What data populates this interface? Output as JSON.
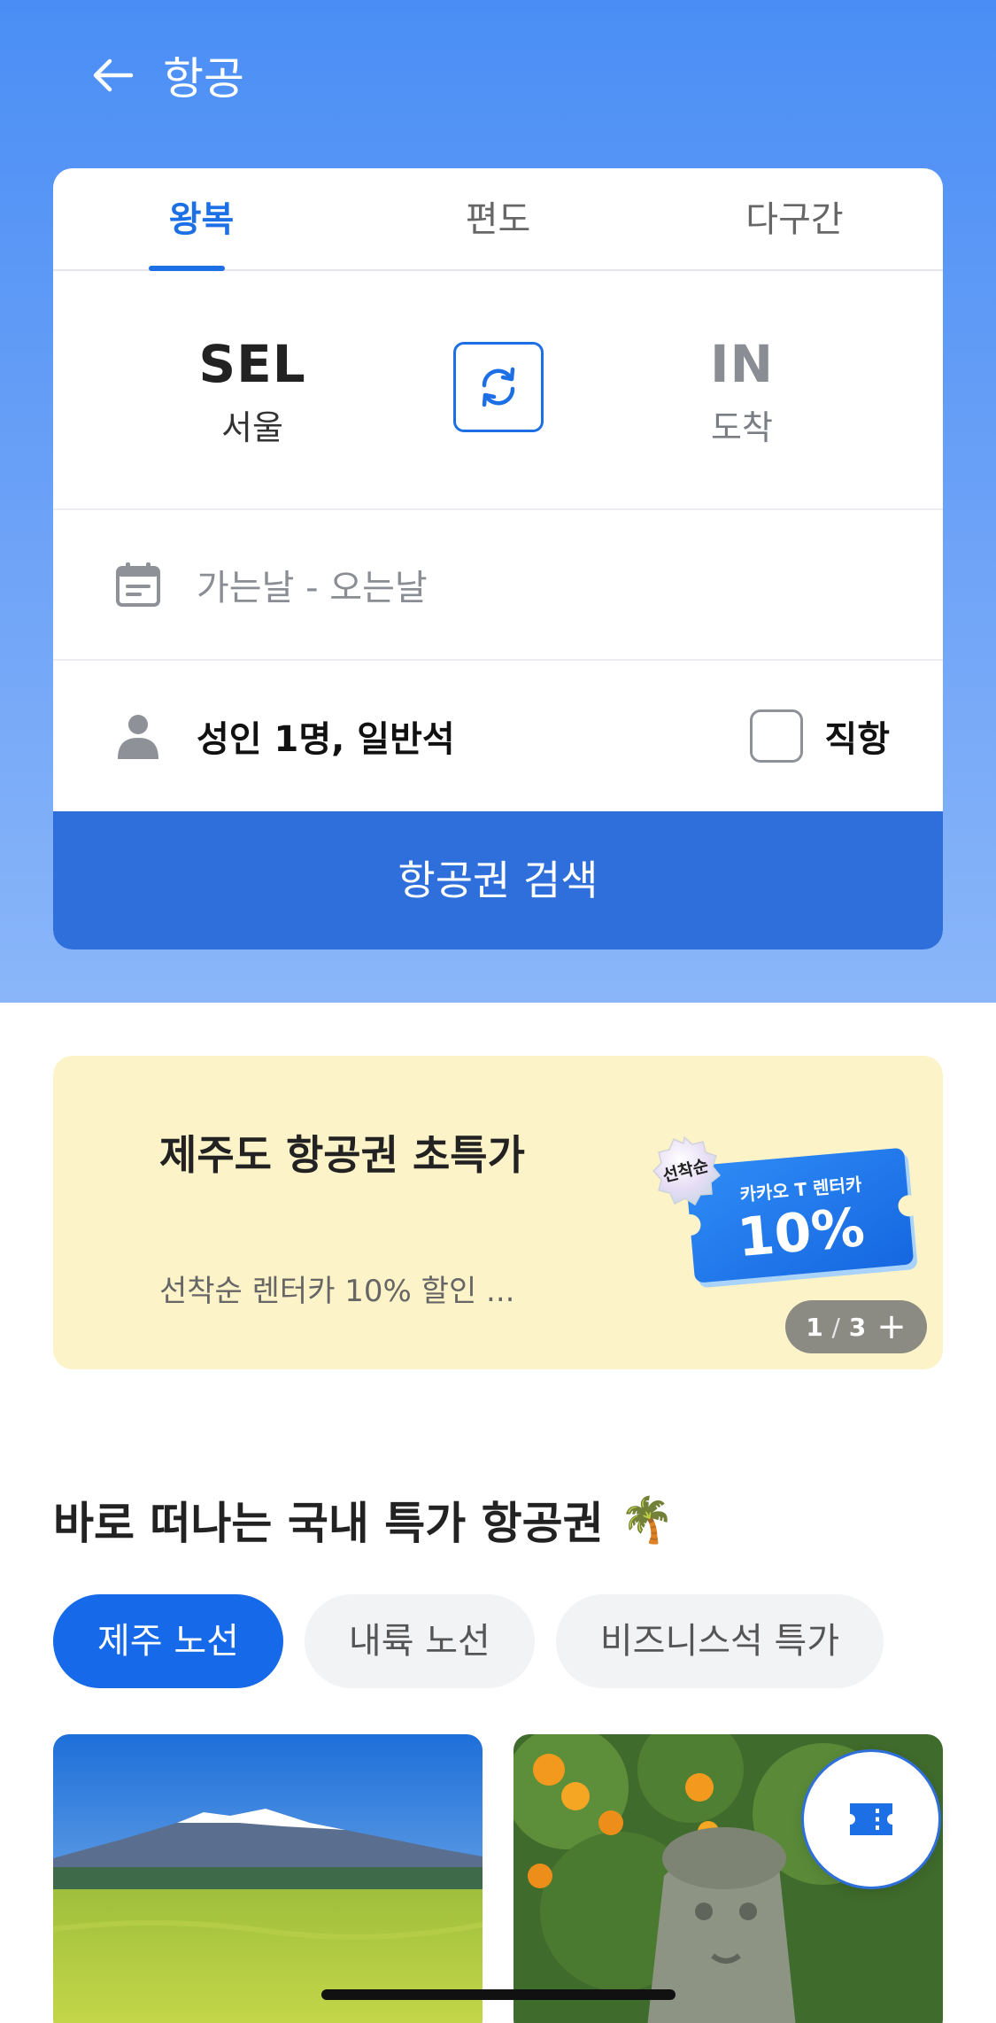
{
  "header": {
    "title": "항공",
    "back_icon": "arrow-left-icon"
  },
  "trip_tabs": [
    {
      "label": "왕복",
      "active": true
    },
    {
      "label": "편도",
      "active": false
    },
    {
      "label": "다구간",
      "active": false
    }
  ],
  "route": {
    "departure": {
      "code": "SEL",
      "name": "서울"
    },
    "arrival": {
      "code": "IN",
      "name": "도착"
    },
    "swap_icon": "swap-arrows-icon"
  },
  "dates": {
    "placeholder": "가는날 - 오는날",
    "icon": "calendar-icon"
  },
  "passengers": {
    "label": "성인 1명, 일반석",
    "icon": "person-icon"
  },
  "direct": {
    "label": "직항",
    "checked": false
  },
  "search_button": {
    "label": "항공권 검색"
  },
  "banner": {
    "title": "제주도 항공권 초특가",
    "subtitle": "선착순 렌터카 10% 할인 ...",
    "coupon": {
      "badge": "선착순",
      "caption": "카카오 T 렌터카",
      "percent": "10%"
    },
    "pager": {
      "current": "1",
      "separator": "/",
      "total": "3",
      "plus": "+"
    }
  },
  "section": {
    "title": "바로 떠나는 국내 특가 항공권",
    "emoji": "🌴"
  },
  "chips": [
    {
      "label": "제주 노선",
      "active": true
    },
    {
      "label": "내륙 노선",
      "active": false
    },
    {
      "label": "비즈니스석 특가",
      "active": false
    }
  ],
  "fab": {
    "icon": "ticket-icon"
  },
  "colors": {
    "primary": "#1d6fe6",
    "search_button": "#2f6fdb",
    "banner_bg": "#fdf3c9",
    "hero_top": "#4a8ef5"
  }
}
